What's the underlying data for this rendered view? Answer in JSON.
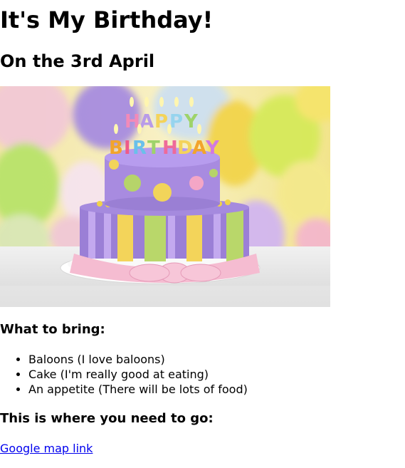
{
  "header": {
    "title": "It's My Birthday!",
    "date": "On the 3rd April"
  },
  "hero_image": {
    "cake_letters_top": "HAPPY",
    "cake_letters_bottom": "BIRTHDAY"
  },
  "bring": {
    "heading": "What to bring:",
    "items": [
      "Baloons (I love baloons)",
      "Cake (I'm really good at eating)",
      "An appetite (There will be lots of food)"
    ]
  },
  "location": {
    "heading": "This is where you need to go:",
    "link_label": "Google map link"
  },
  "colors": {
    "link": "#0000ee",
    "text": "#000000"
  }
}
